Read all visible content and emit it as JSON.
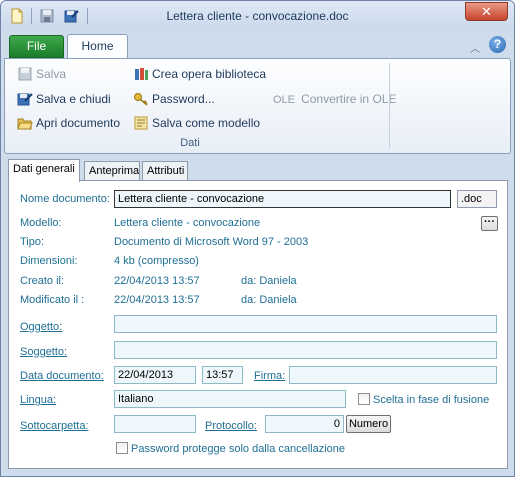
{
  "window": {
    "title": "Lettera cliente - convocazione.doc",
    "close_glyph": "✕"
  },
  "ribbon": {
    "file_tab": "File",
    "home_tab": "Home",
    "help_glyph": "?",
    "collapse_glyph": "︿",
    "buttons": {
      "salva": "Salva",
      "salva_chiudi": "Salva e chiudi",
      "apri_documento": "Apri documento",
      "crea_opera": "Crea opera biblioteca",
      "password": "Password...",
      "salva_modello": "Salva come modello",
      "ole_prefix": "OLE",
      "convertir_ole": "Convertire in OLE"
    },
    "group_label": "Dati"
  },
  "tabs": [
    "Dati generali",
    "Anteprima",
    "Attributi"
  ],
  "form": {
    "nome_documento_label": "Nome documento:",
    "nome_documento_value": "Lettera cliente - convocazione",
    "extension": ".doc",
    "modello_label": "Modello:",
    "modello_value": "Lettera cliente - convocazione",
    "browse_label": "···",
    "tipo_label": "Tipo:",
    "tipo_value": "Documento di Microsoft Word 97 - 2003",
    "dimensioni_label": "Dimensioni:",
    "dimensioni_value": "4 kb (compresso)",
    "creato_label": "Creato il:",
    "creato_value": "22/04/2013 13:57",
    "creato_da": "da: Daniela",
    "modificato_label": "Modificato il :",
    "modificato_value": "22/04/2013 13:57",
    "modificato_da": "da: Daniela",
    "oggetto_label": "Oggetto:",
    "oggetto_value": "",
    "soggetto_label": "Soggetto:",
    "soggetto_value": "",
    "data_documento_label": "Data documento:",
    "data_documento_value": "22/04/2013",
    "ora_value": "13:57",
    "firma_label": "Firma:",
    "firma_value": "",
    "lingua_label": "Lingua:",
    "lingua_value": "Italiano",
    "scelta_fusione_label": "Scelta in fase di fusione",
    "sottocartella_label": "Sottocarpetta:",
    "sottocartella_value": "",
    "protocollo_label": "Protocollo:",
    "protocollo_value": "0",
    "numero_button": "Numero",
    "password_protegge_label": "Password protegge solo dalla cancellazione"
  }
}
